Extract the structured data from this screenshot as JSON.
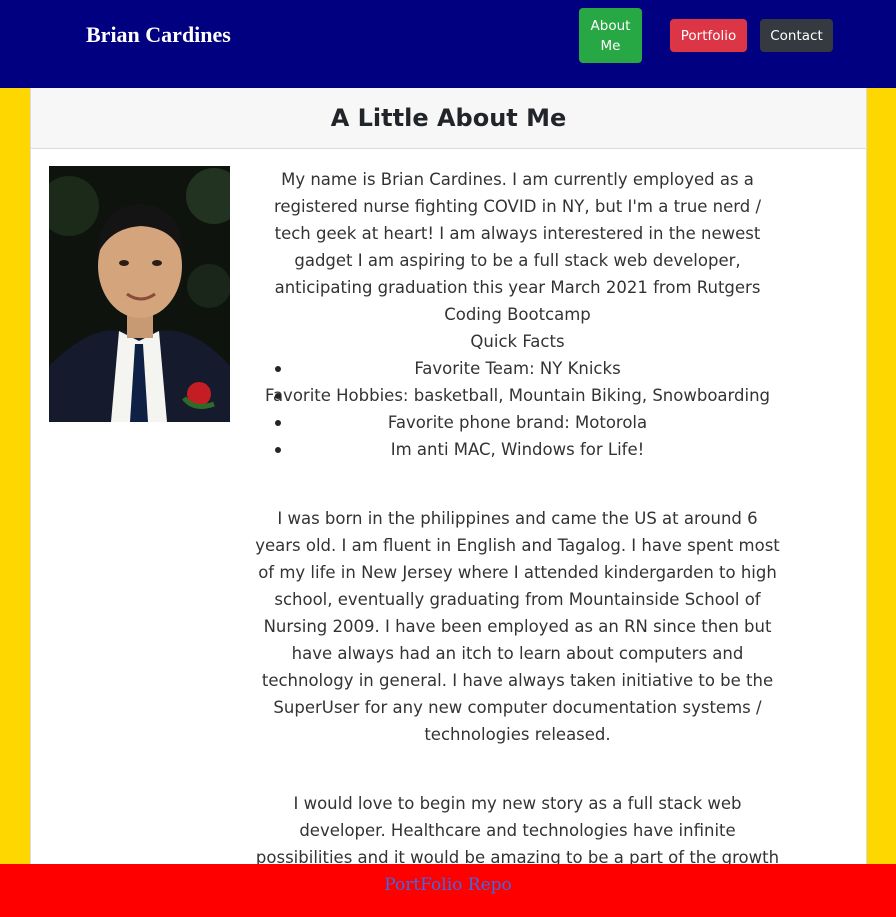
{
  "nav": {
    "brand": "Brian Cardines",
    "about_label": "About Me",
    "portfolio_label": "Portfolio",
    "contact_label": "Contact"
  },
  "card": {
    "title": "A Little About Me",
    "intro": "My name is Brian Cardines. I am currently employed as a registered nurse fighting COVID in NY, but I'm a true nerd / tech geek at heart! I am always interestered in the newest gadget I am aspiring to be a full stack web developer, anticipating graduation this year March 2021 from Rutgers Coding Bootcamp",
    "quick_facts_title": "Quick Facts",
    "quick_facts": [
      "Favorite Team: NY Knicks",
      "Favorite Hobbies: basketball, Mountain Biking, Snowboarding",
      "Favorite phone brand: Motorola",
      "Im anti MAC, Windows for Life!"
    ],
    "paragraph2": "I was born in the philippines and came the US at around 6 years old. I am fluent in English and Tagalog. I have spent most of my life in New Jersey where I attended kindergarden to high school, eventually graduating from Mountainside School of Nursing 2009. I have been employed as an RN since then but have always had an itch to learn about computers and technology in general. I have always taken initiative to be the SuperUser for any new computer documentation systems / technologies released.",
    "paragraph3": "I would love to begin my new story as a full stack web developer. Healthcare and technologies have infinite possibilities and it would be amazing to be a part of the growth with existing technologies and discovery of new ones. I have a vast knowledge"
  },
  "footer": {
    "link_label": "PortFolio Repo"
  },
  "colors": {
    "navbar": "#000080",
    "side_background": "#ffd700",
    "footer": "#ff0000",
    "about_button": "#28a745",
    "portfolio_button": "#dc3545",
    "contact_button": "#343a40",
    "footer_link": "#4169e1"
  }
}
